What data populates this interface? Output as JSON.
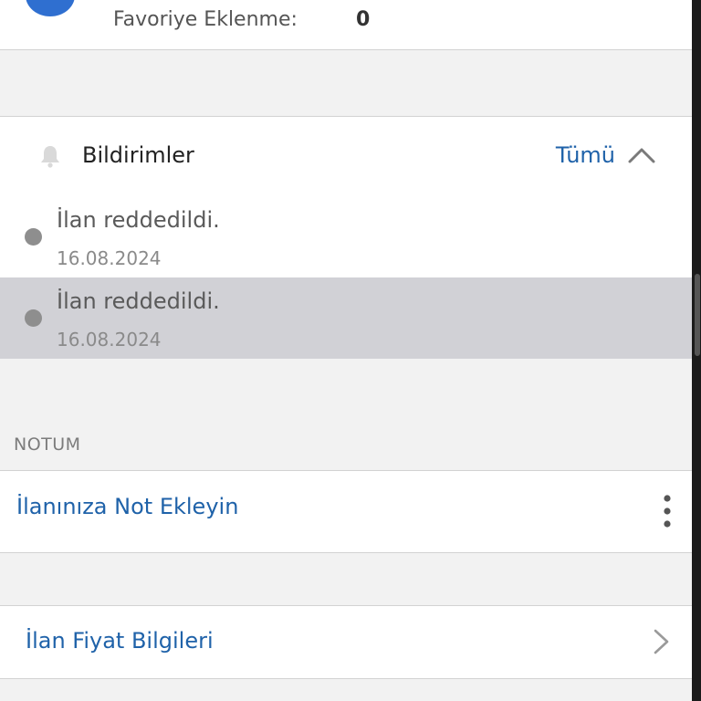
{
  "stats": {
    "favorite_label": "Favoriye Eklenme:",
    "favorite_value": "0"
  },
  "notifications": {
    "title": "Bildirimler",
    "all_label": "Tümü",
    "items": [
      {
        "text": "İlan reddedildi.",
        "date": "16.08.2024"
      },
      {
        "text": "İlan reddedildi.",
        "date": "16.08.2024"
      }
    ]
  },
  "notes": {
    "caption": "NOTUM",
    "add_note_label": "İlanınıza Not Ekleyin"
  },
  "price": {
    "label": "İlan Fiyat Bilgileri"
  },
  "colors": {
    "accent": "#1f62a9",
    "avatar": "#2f6fd0",
    "selected_row": "#d1d1d6",
    "background": "#f2f2f2"
  },
  "icons": {
    "bell": "bell-icon",
    "chevron_up": "chevron-up-icon",
    "more": "more-vertical-icon",
    "chevron_right": "chevron-right-icon"
  }
}
